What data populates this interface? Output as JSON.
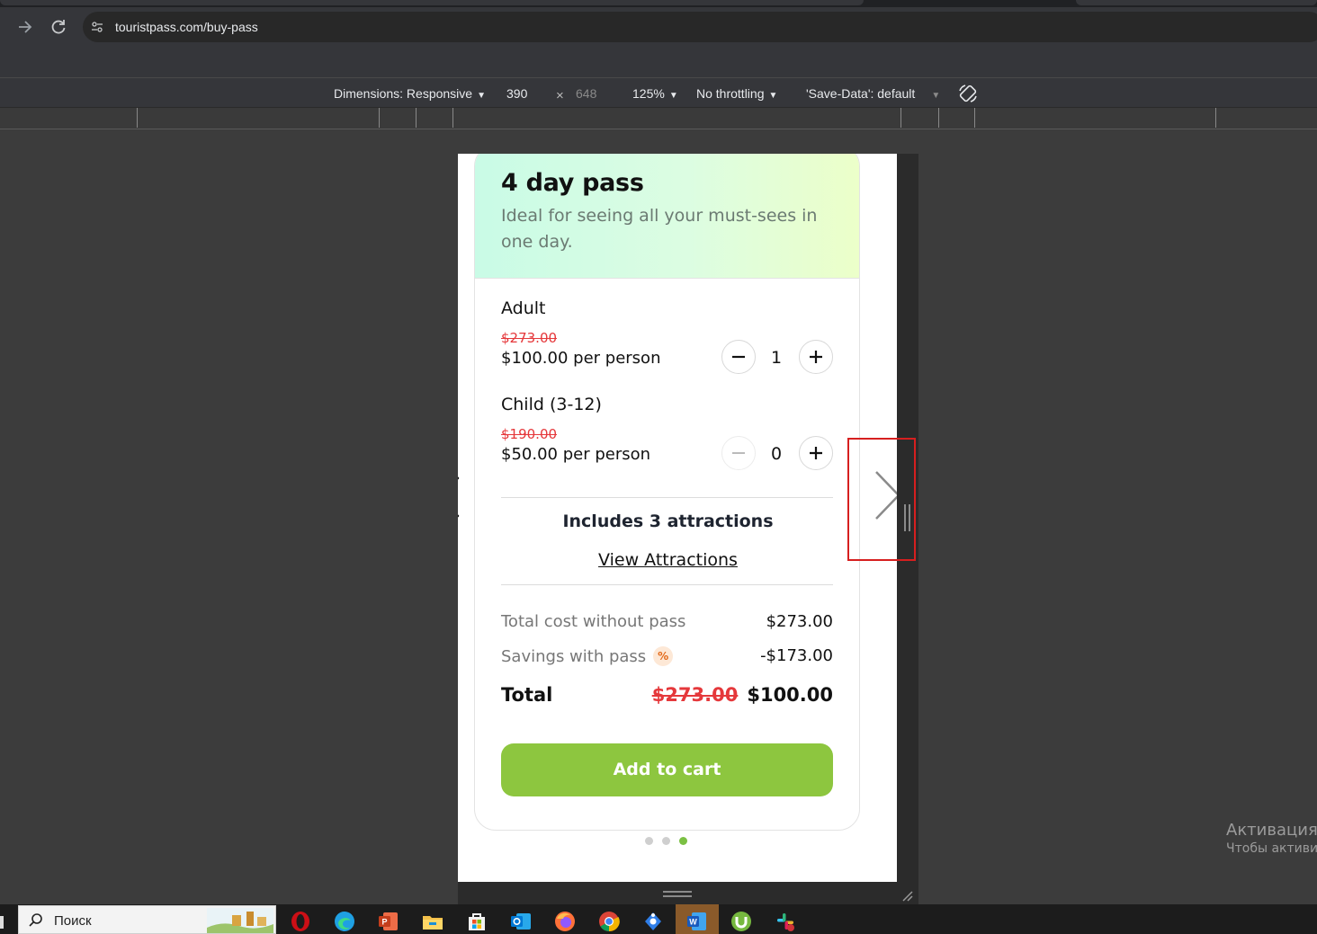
{
  "browser": {
    "url": "touristpass.com/buy-pass",
    "back_icon": "arrow-right-icon",
    "reload_icon": "reload-icon"
  },
  "devtools": {
    "dimensions_label": "Dimensions: Responsive",
    "width": "390",
    "times": "×",
    "height": "648",
    "zoom": "125%",
    "throttling": "No throttling",
    "save_data": "'Save-Data': default"
  },
  "pass": {
    "title": "4 day pass",
    "description": "Ideal for seeing all your must-sees in one day.",
    "tickets": [
      {
        "label": "Adult",
        "old_price": "$273.00",
        "price": "$100.00 per person",
        "quantity": "1",
        "minus_enabled": true
      },
      {
        "label": "Child (3-12)",
        "old_price": "$190.00",
        "price": "$50.00 per person",
        "quantity": "0",
        "minus_enabled": false
      }
    ],
    "includes": "Includes 3 attractions",
    "view_attractions": "View Attractions",
    "summary": {
      "total_without_label": "Total cost without pass",
      "total_without_value": "$273.00",
      "savings_label": "Savings with pass",
      "savings_badge": "%",
      "savings_value": "-$173.00",
      "total_label": "Total",
      "total_old": "$273.00",
      "total_new": "$100.00"
    },
    "add_to_cart": "Add to cart",
    "carousel": {
      "count": 3,
      "active_index": 2
    }
  },
  "windows": {
    "activation_line1": "Активация",
    "activation_line2": "Чтобы активир",
    "search_placeholder": "Поиск"
  },
  "colors": {
    "accent_green": "#8dc63f",
    "strike_red": "#e5383b",
    "highlight_red": "#d61f1f"
  },
  "taskbar_icons": [
    "opera-icon",
    "edge-icon",
    "powerpoint-icon",
    "file-explorer-icon",
    "store-icon",
    "outlook-icon",
    "firefox-icon",
    "chrome-icon",
    "network-icon",
    "word-icon",
    "utorrent-icon",
    "slack-icon"
  ]
}
